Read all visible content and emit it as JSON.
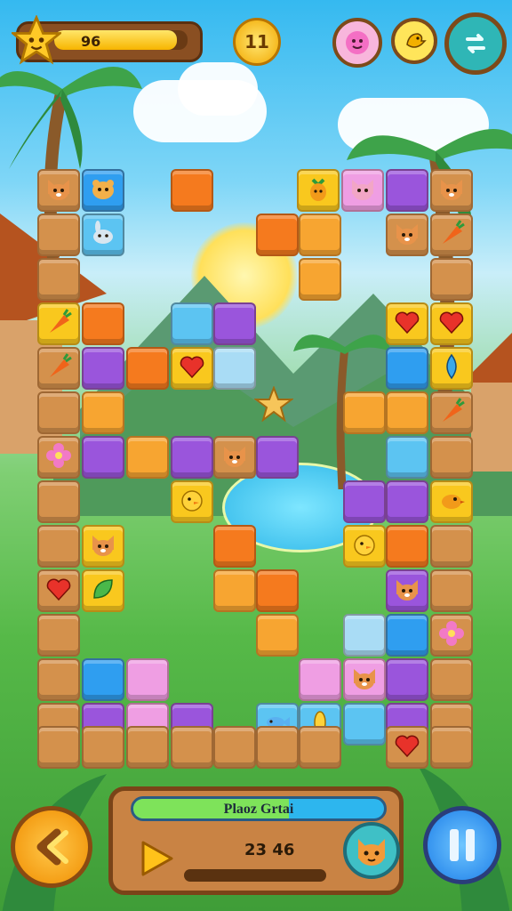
{
  "hud": {
    "progress_text": "96",
    "progress": 0.92,
    "coin_count": "11"
  },
  "panel": {
    "level_label": "Plaoz Grtai",
    "level_progress": 0.62,
    "score": "23 46"
  },
  "icons": {
    "top": [
      "star-icon",
      "coin-icon",
      "smiley-icon",
      "bird-icon",
      "swap-icon"
    ],
    "bottom": [
      "back-arrow-icon",
      "play-icon",
      "cat-face-icon",
      "pause-icon"
    ]
  },
  "colors": {
    "wood": "#d4914c",
    "orange": "#f57a1e",
    "amber": "#f7a531",
    "yellow": "#f9c81e",
    "blue": "#2f9ef0",
    "sky": "#5cc4f2",
    "pale": "#a9dcf5",
    "purple": "#9a55dc",
    "pink": "#ef9ee3"
  },
  "board": {
    "tiles": [
      [
        "wood",
        "cat"
      ],
      [
        "blue",
        "hamster"
      ],
      [
        "orange",
        ""
      ],
      [
        "yellow",
        "pineapple"
      ],
      [
        "pink",
        "kitten"
      ],
      [
        "purple",
        ""
      ],
      [
        "wood",
        "cat"
      ],
      [
        "wood",
        ""
      ],
      [
        "sky",
        "bunny"
      ],
      [
        "orange",
        ""
      ],
      [
        "amber",
        ""
      ],
      [
        "wood",
        "cat"
      ],
      [
        "wood",
        "carrot"
      ],
      [
        "wood",
        ""
      ],
      [
        "amber",
        ""
      ],
      [
        "wood",
        ""
      ],
      [
        "yellow",
        "carrot"
      ],
      [
        "orange",
        ""
      ],
      [
        "sky",
        ""
      ],
      [
        "purple",
        ""
      ],
      [
        "yellow",
        "heart"
      ],
      [
        "yellow",
        "heart"
      ],
      [
        "wood",
        "carrot"
      ],
      [
        "purple",
        ""
      ],
      [
        "orange",
        ""
      ],
      [
        "yellow",
        "heart"
      ],
      [
        "pale",
        ""
      ],
      [
        "blue",
        ""
      ],
      [
        "yellow",
        "drop"
      ],
      [
        "wood",
        ""
      ],
      [
        "amber",
        ""
      ],
      [
        "amber",
        ""
      ],
      [
        "amber",
        ""
      ],
      [
        "wood",
        "carrot"
      ],
      [
        "wood",
        "flower"
      ],
      [
        "purple",
        ""
      ],
      [
        "amber",
        ""
      ],
      [
        "purple",
        ""
      ],
      [
        "wood",
        "cat"
      ],
      [
        "purple",
        ""
      ],
      [
        "sky",
        ""
      ],
      [
        "wood",
        ""
      ],
      [
        "wood",
        ""
      ],
      [
        "yellow",
        "chick"
      ],
      [
        "purple",
        ""
      ],
      [
        "purple",
        ""
      ],
      [
        "yellow",
        "bird"
      ],
      [
        "wood",
        ""
      ],
      [
        "yellow",
        "cat"
      ],
      [
        "orange",
        ""
      ],
      [
        "yellow",
        "chick"
      ],
      [
        "orange",
        ""
      ],
      [
        "wood",
        ""
      ],
      [
        "wood",
        "heart"
      ],
      [
        "yellow",
        "leaf"
      ],
      [
        "amber",
        ""
      ],
      [
        "orange",
        ""
      ],
      [
        "purple",
        "cat"
      ],
      [
        "wood",
        ""
      ],
      [
        "wood",
        ""
      ],
      [
        "amber",
        ""
      ],
      [
        "pale",
        ""
      ],
      [
        "blue",
        ""
      ],
      [
        "wood",
        "flower"
      ],
      [
        "wood",
        ""
      ],
      [
        "blue",
        ""
      ],
      [
        "pink",
        ""
      ],
      [
        "pink",
        ""
      ],
      [
        "pink",
        "cat"
      ],
      [
        "purple",
        ""
      ],
      [
        "wood",
        ""
      ],
      [
        "wood",
        ""
      ],
      [
        "purple",
        ""
      ],
      [
        "pink",
        ""
      ],
      [
        "purple",
        ""
      ],
      [
        "sky",
        "fish"
      ],
      [
        "sky",
        "corn"
      ],
      [
        "sky",
        ""
      ],
      [
        "purple",
        ""
      ],
      [
        "wood",
        ""
      ],
      [
        "wood",
        ""
      ],
      [
        "wood",
        ""
      ],
      [
        "wood",
        ""
      ],
      [
        "wood",
        ""
      ],
      [
        "wood",
        ""
      ],
      [
        "wood",
        ""
      ],
      [
        "wood",
        ""
      ],
      [
        "wood",
        "heart"
      ],
      [
        "wood",
        ""
      ]
    ]
  }
}
